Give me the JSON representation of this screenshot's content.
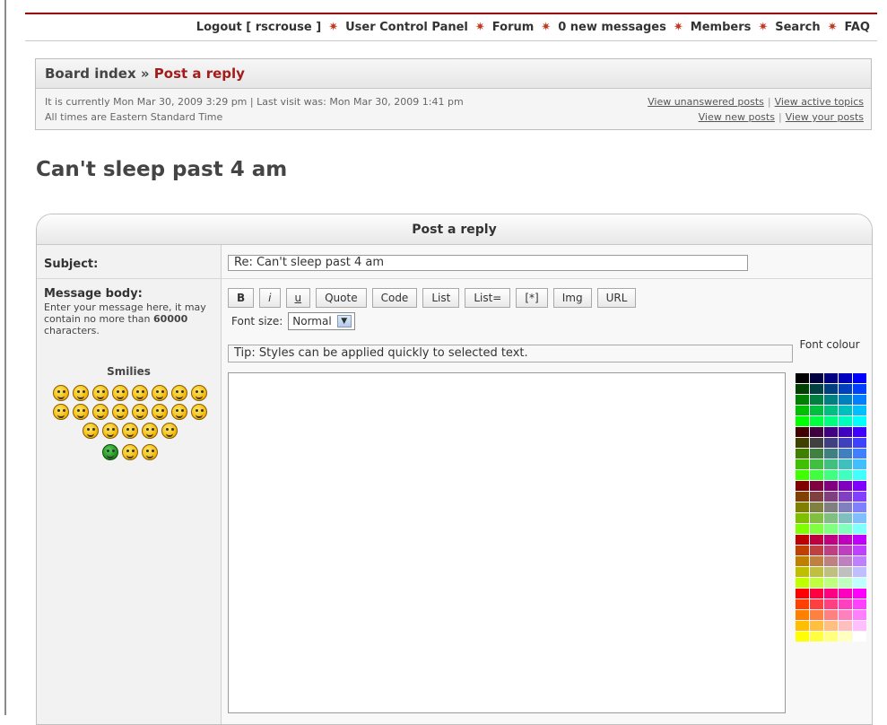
{
  "nav": {
    "logout": "Logout [ rscrouse ]",
    "ucp": "User Control Panel",
    "forum": "Forum",
    "messages": "0 new messages",
    "members": "Members",
    "search": "Search",
    "faq": "FAQ",
    "separator_icon": "maple-leaf-icon"
  },
  "breadcrumb": {
    "index": "Board index",
    "sep": " » ",
    "current": "Post a reply"
  },
  "info": {
    "time": "It is currently Mon Mar 30, 2009 3:29 pm | Last visit was: Mon Mar 30, 2009 1:41 pm",
    "timezone": "All times are Eastern Standard Time",
    "unanswered": "View unanswered posts",
    "active": "View active topics",
    "newposts": "View new posts",
    "yourposts": "View your posts",
    "bar": "|"
  },
  "topic_title": "Can't sleep past 4 am",
  "form": {
    "header": "Post a reply",
    "subject_label": "Subject:",
    "subject_value": "Re: Can't sleep past 4 am",
    "body_label": "Message body:",
    "hint_pre": "Enter your message here, it may contain no more than ",
    "hint_num": "60000",
    "hint_post": " characters.",
    "smilies_label": "Smilies",
    "buttons": [
      "B",
      "i",
      "u",
      "Quote",
      "Code",
      "List",
      "List=",
      "[*]",
      "Img",
      "URL"
    ],
    "font_size_label": "Font size:",
    "font_size_value": "Normal",
    "tip": "Tip: Styles can be applied quickly to selected text.",
    "font_colour_label": "Font colour"
  },
  "smiley_icons": [
    "very-happy-icon",
    "smile-icon",
    "wink-icon",
    "sad-icon",
    "surprised-icon",
    "shocked-icon",
    "confused-icon",
    "cool-icon",
    "laughing-icon",
    "mad-icon",
    "razz-icon",
    "embarrassed-icon",
    "crying-icon",
    "evil-icon",
    "twisted-evil-icon",
    "rolleyes-icon",
    "exclaim-icon",
    "question-icon",
    "idea-icon",
    "arrow-icon",
    "neutral-icon",
    "mr-green-icon",
    "geek-icon",
    "uber-geek-icon"
  ],
  "colors": {
    "accent": "#a31b1b",
    "nav_rule": "#9a0000",
    "leaf": "#c03a20"
  }
}
